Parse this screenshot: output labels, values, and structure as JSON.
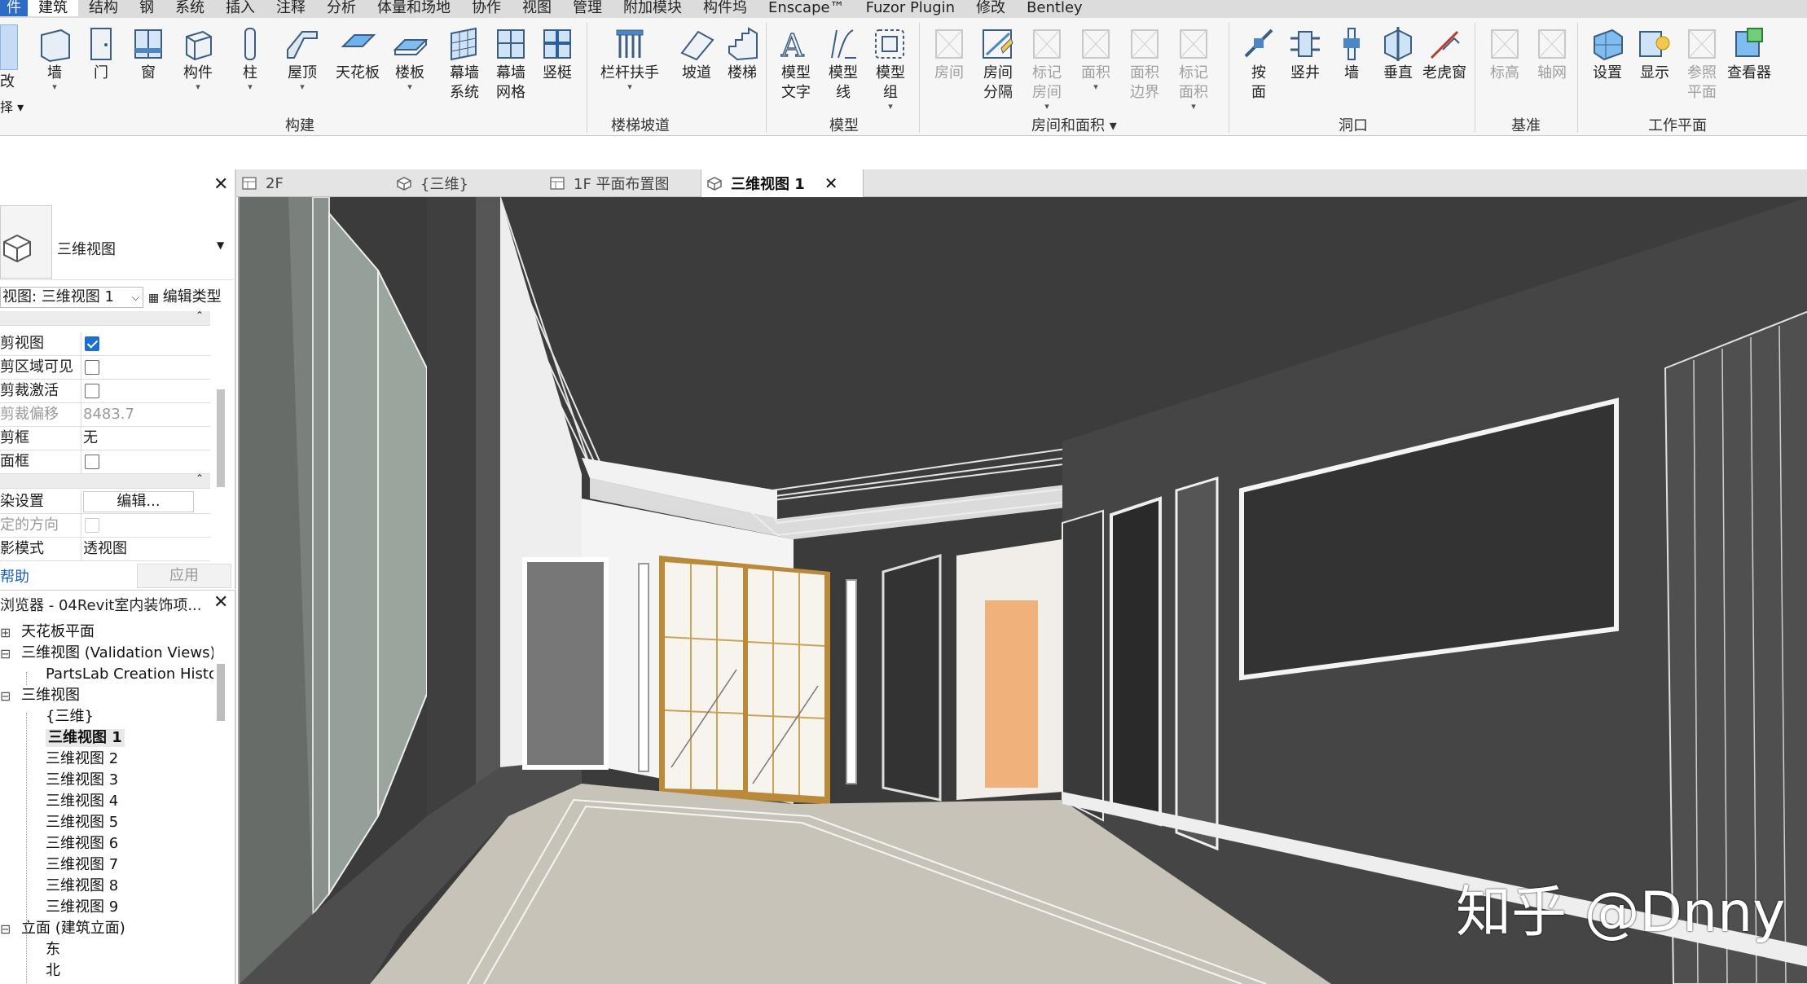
{
  "menu": {
    "items": [
      "件",
      "建筑",
      "结构",
      "钢",
      "系统",
      "插入",
      "注释",
      "分析",
      "体量和场地",
      "协作",
      "视图",
      "管理",
      "附加模块",
      "构件坞",
      "Enscape™",
      "Fuzor Plugin",
      "修改",
      "Bentley"
    ],
    "active": "建筑"
  },
  "ribbon": {
    "left_edge": {
      "modify_label": "改",
      "select_label": "择 ▾"
    },
    "build_panel": {
      "title": "构建",
      "buttons": [
        {
          "label": "墙",
          "icon": "wall-icon",
          "dropdown": true
        },
        {
          "label": "门",
          "icon": "door-icon"
        },
        {
          "label": "窗",
          "icon": "window-icon"
        },
        {
          "label": "构件",
          "icon": "component-icon",
          "dropdown": true
        },
        {
          "label": "柱",
          "icon": "column-icon",
          "dropdown": true
        },
        {
          "label": "屋顶",
          "icon": "roof-icon",
          "dropdown": true
        },
        {
          "label": "天花板",
          "icon": "ceiling-icon"
        },
        {
          "label": "楼板",
          "icon": "floor-icon",
          "dropdown": true
        },
        {
          "label": "幕墙\n系统",
          "icon": "curtain-system-icon"
        },
        {
          "label": "幕墙\n网格",
          "icon": "curtain-grid-icon"
        },
        {
          "label": "竖梃",
          "icon": "mullion-icon"
        }
      ]
    },
    "circulation_panel": {
      "title": "楼梯坡道",
      "buttons": [
        {
          "label": "栏杆扶手",
          "icon": "railing-icon",
          "dropdown": true
        },
        {
          "label": "坡道",
          "icon": "ramp-icon"
        },
        {
          "label": "楼梯",
          "icon": "stair-icon"
        }
      ]
    },
    "model_panel": {
      "title": "模型",
      "buttons": [
        {
          "label": "模型\n文字",
          "icon": "model-text-icon"
        },
        {
          "label": "模型\n线",
          "icon": "model-line-icon"
        },
        {
          "label": "模型\n组",
          "icon": "model-group-icon",
          "dropdown": true
        }
      ]
    },
    "room_panel": {
      "title": "房间和面积 ▾",
      "buttons": [
        {
          "label": "房间",
          "icon": "room-icon",
          "disabled": true
        },
        {
          "label": "房间\n分隔",
          "icon": "room-separator-icon"
        },
        {
          "label": "标记\n房间",
          "icon": "tag-room-icon",
          "disabled": true,
          "dropdown": true
        },
        {
          "label": "面积",
          "icon": "area-icon",
          "disabled": true,
          "dropdown": true
        },
        {
          "label": "面积\n边界",
          "icon": "area-boundary-icon",
          "disabled": true
        },
        {
          "label": "标记\n面积",
          "icon": "tag-area-icon",
          "disabled": true,
          "dropdown": true
        }
      ]
    },
    "opening_panel": {
      "title": "洞口",
      "buttons": [
        {
          "label": "按\n面",
          "icon": "opening-by-face-icon"
        },
        {
          "label": "竖井",
          "icon": "shaft-icon"
        },
        {
          "label": "墙",
          "icon": "wall-opening-icon"
        },
        {
          "label": "垂直",
          "icon": "vertical-opening-icon"
        },
        {
          "label": "老虎窗",
          "icon": "dormer-icon"
        }
      ]
    },
    "datum_panel": {
      "title": "基准",
      "buttons": [
        {
          "label": "标高",
          "icon": "level-icon",
          "disabled": true
        },
        {
          "label": "轴网",
          "icon": "grid-icon",
          "disabled": true
        }
      ]
    },
    "workplane_panel": {
      "title": "工作平面",
      "buttons": [
        {
          "label": "设置",
          "icon": "set-workplane-icon"
        },
        {
          "label": "显示",
          "icon": "show-workplane-icon"
        },
        {
          "label": "参照\n平面",
          "icon": "ref-plane-icon",
          "disabled": true
        },
        {
          "label": "查看器",
          "icon": "viewer-icon"
        }
      ]
    }
  },
  "view_tabs": [
    {
      "label": "2F",
      "icon": "plan-view-icon"
    },
    {
      "label": "{三维}",
      "icon": "3d-view-icon"
    },
    {
      "label": "1F 平面布置图",
      "icon": "plan-view-icon"
    },
    {
      "label": "三维视图 1",
      "icon": "3d-view-icon",
      "active": true
    }
  ],
  "properties": {
    "type_name": "三维视图",
    "view_selector": "视图: 三维视图 1",
    "edit_type": "编辑类型",
    "rows": [
      {
        "key": "剪视图",
        "type": "checkbox",
        "checked": true
      },
      {
        "key": "剪区域可见",
        "type": "checkbox",
        "checked": false
      },
      {
        "key": "剪裁激活",
        "type": "checkbox",
        "checked": false
      },
      {
        "key": "剪裁偏移",
        "type": "text",
        "value": "8483.7",
        "grey": true
      },
      {
        "key": "剪框",
        "type": "text",
        "value": "无"
      },
      {
        "key": "面框",
        "type": "checkbox",
        "checked": false
      },
      {
        "key": "染设置",
        "type": "button",
        "value": "编辑..."
      },
      {
        "key": "定的方向",
        "type": "checkbox",
        "checked": false,
        "grey": true
      },
      {
        "key": "影模式",
        "type": "text",
        "value": "透视图"
      }
    ],
    "help": "帮助",
    "apply": "应用"
  },
  "browser": {
    "title": "浏览器 - 04Revit室内装饰项...",
    "tree": [
      {
        "label": "天花板平面",
        "level": 0,
        "expander": "⊞"
      },
      {
        "label": "三维视图 (Validation Views)",
        "level": 0,
        "expander": "⊟"
      },
      {
        "label": "PartsLab Creation History",
        "level": 1
      },
      {
        "label": "三维视图",
        "level": 0,
        "expander": "⊟"
      },
      {
        "label": "{三维}",
        "level": 1
      },
      {
        "label": "三维视图 1",
        "level": 1,
        "selected": true
      },
      {
        "label": "三维视图 2",
        "level": 1
      },
      {
        "label": "三维视图 3",
        "level": 1
      },
      {
        "label": "三维视图 4",
        "level": 1
      },
      {
        "label": "三维视图 5",
        "level": 1
      },
      {
        "label": "三维视图 6",
        "level": 1
      },
      {
        "label": "三维视图 7",
        "level": 1
      },
      {
        "label": "三维视图 8",
        "level": 1
      },
      {
        "label": "三维视图 9",
        "level": 1
      },
      {
        "label": "立面 (建筑立面)",
        "level": 0,
        "expander": "⊟"
      },
      {
        "label": "东",
        "level": 1
      },
      {
        "label": "北",
        "level": 1
      }
    ]
  },
  "watermark": "知乎 @Dnny",
  "colors": {
    "accent": "#2b6cc4",
    "ceiling": "#3c3c3c",
    "floor": "#c7c2b8",
    "wall": "#444444",
    "door_wood": "#b98a3a"
  }
}
